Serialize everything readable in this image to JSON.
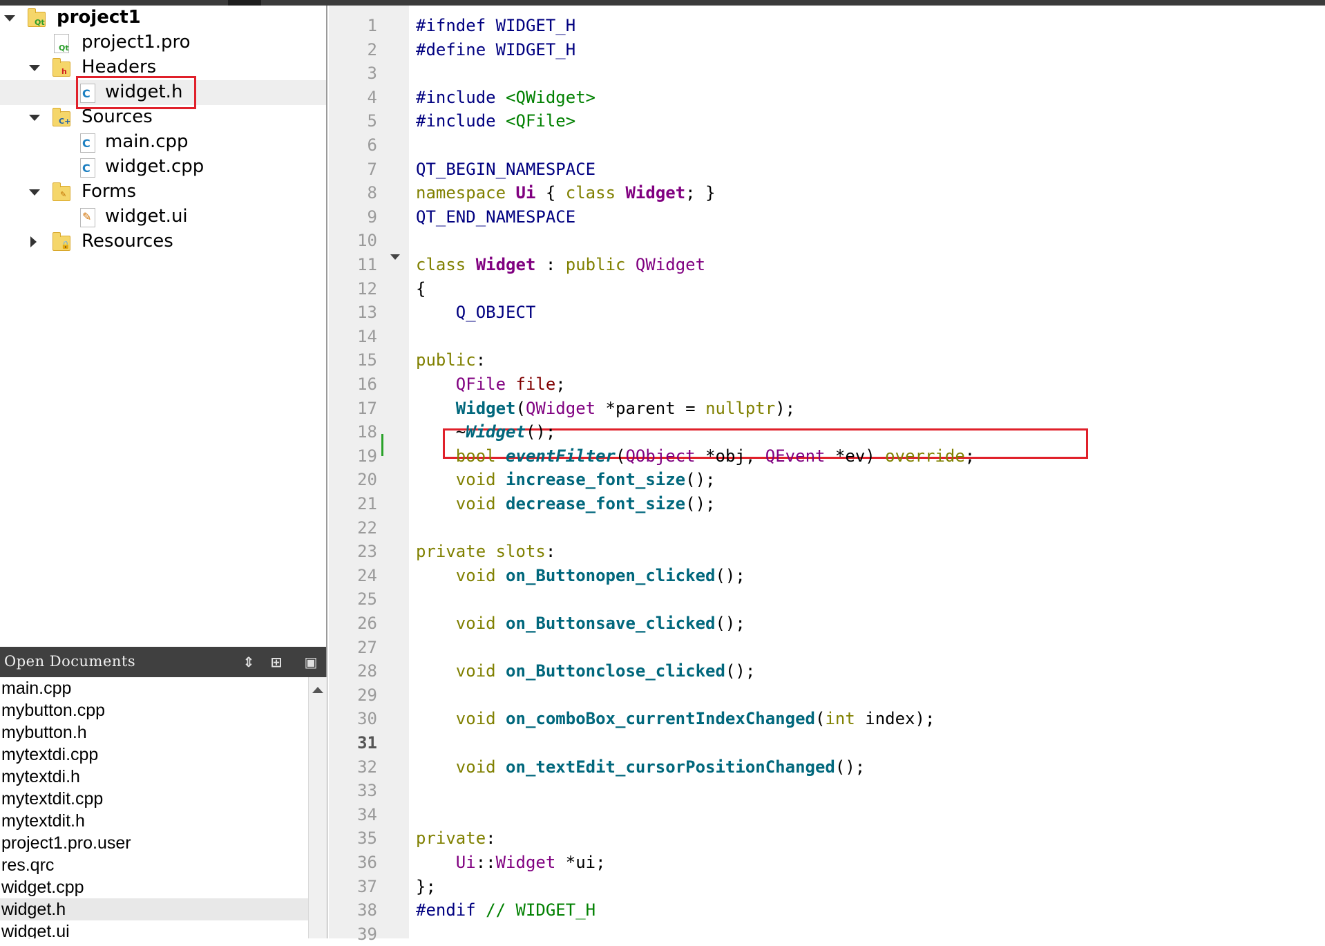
{
  "project_tree": {
    "root": "project1",
    "items": [
      {
        "label": "project1.pro",
        "type": "pro-file"
      },
      {
        "label": "Headers",
        "type": "folder"
      },
      {
        "label": "widget.h",
        "type": "header-file"
      },
      {
        "label": "Sources",
        "type": "folder"
      },
      {
        "label": "main.cpp",
        "type": "source-file"
      },
      {
        "label": "widget.cpp",
        "type": "source-file"
      },
      {
        "label": "Forms",
        "type": "folder"
      },
      {
        "label": "widget.ui",
        "type": "ui-file"
      },
      {
        "label": "Resources",
        "type": "folder"
      }
    ]
  },
  "open_documents": {
    "title": "Open Documents",
    "items": [
      "main.cpp",
      "mybutton.cpp",
      "mybutton.h",
      "mytextdi.cpp",
      "mytextdi.h",
      "mytextdit.cpp",
      "mytextdit.h",
      "project1.pro.user",
      "res.qrc",
      "widget.cpp",
      "widget.h",
      "widget.ui"
    ],
    "current": "widget.h"
  },
  "editor": {
    "current_line": "31",
    "line_numbers": [
      "1",
      "2",
      "3",
      "4",
      "5",
      "6",
      "7",
      "8",
      "9",
      "10",
      "11",
      "12",
      "13",
      "14",
      "15",
      "16",
      "17",
      "18",
      "19",
      "20",
      "21",
      "22",
      "23",
      "24",
      "25",
      "26",
      "27",
      "28",
      "29",
      "30",
      "31",
      "32",
      "33",
      "34",
      "35",
      "36",
      "37",
      "38",
      "39"
    ],
    "lines": [
      [
        "#ifndef WIDGET_H"
      ],
      [
        "#define WIDGET_H"
      ],
      [
        ""
      ],
      [
        "#include ",
        "<QWidget>"
      ],
      [
        "#include ",
        "<QFile>"
      ],
      [
        ""
      ],
      [
        "QT_BEGIN_NAMESPACE"
      ],
      [
        "namespace ",
        "Ui",
        " { ",
        "class ",
        "Widget",
        "; }"
      ],
      [
        "QT_END_NAMESPACE"
      ],
      [
        ""
      ],
      [
        "class ",
        "Widget",
        " : ",
        "public ",
        "QWidget"
      ],
      [
        "{"
      ],
      [
        "    Q_OBJECT"
      ],
      [
        ""
      ],
      [
        "public",
        ":"
      ],
      [
        "    ",
        "QFile",
        " ",
        "file",
        ";"
      ],
      [
        "    ",
        "Widget",
        "(",
        "QWidget",
        " *parent = ",
        "nullptr",
        ");"
      ],
      [
        "    ~",
        "Widget",
        "();"
      ],
      [
        "    ",
        "bool",
        " ",
        "eventFilter",
        "(",
        "QObject",
        " *obj, ",
        "QEvent",
        " *ev) ",
        "override",
        ";"
      ],
      [
        "    ",
        "void",
        " ",
        "increase_font_size",
        "();"
      ],
      [
        "    ",
        "void",
        " ",
        "decrease_font_size",
        "();"
      ],
      [
        ""
      ],
      [
        "private ",
        "slots",
        ":"
      ],
      [
        "    ",
        "void",
        " ",
        "on_Buttonopen_clicked",
        "();"
      ],
      [
        ""
      ],
      [
        "    ",
        "void",
        " ",
        "on_Buttonsave_clicked",
        "();"
      ],
      [
        ""
      ],
      [
        "    ",
        "void",
        " ",
        "on_Buttonclose_clicked",
        "();"
      ],
      [
        ""
      ],
      [
        "    ",
        "void",
        " ",
        "on_comboBox_currentIndexChanged",
        "(",
        "int",
        " index);"
      ],
      [
        ""
      ],
      [
        "    ",
        "void",
        " ",
        "on_textEdit_cursorPositionChanged",
        "();"
      ],
      [
        ""
      ],
      [
        ""
      ],
      [
        "private",
        ":"
      ],
      [
        "    ",
        "Ui",
        "::",
        "Widget",
        " *ui;"
      ],
      [
        "};"
      ],
      [
        "#endif ",
        "// WIDGET_H"
      ],
      [
        ""
      ]
    ]
  },
  "colors": {
    "keyword": "#808000",
    "type": "#800080",
    "function": "#00677c",
    "preprocessor": "#000080",
    "string": "#008000",
    "highlight_box": "#e0202a"
  }
}
